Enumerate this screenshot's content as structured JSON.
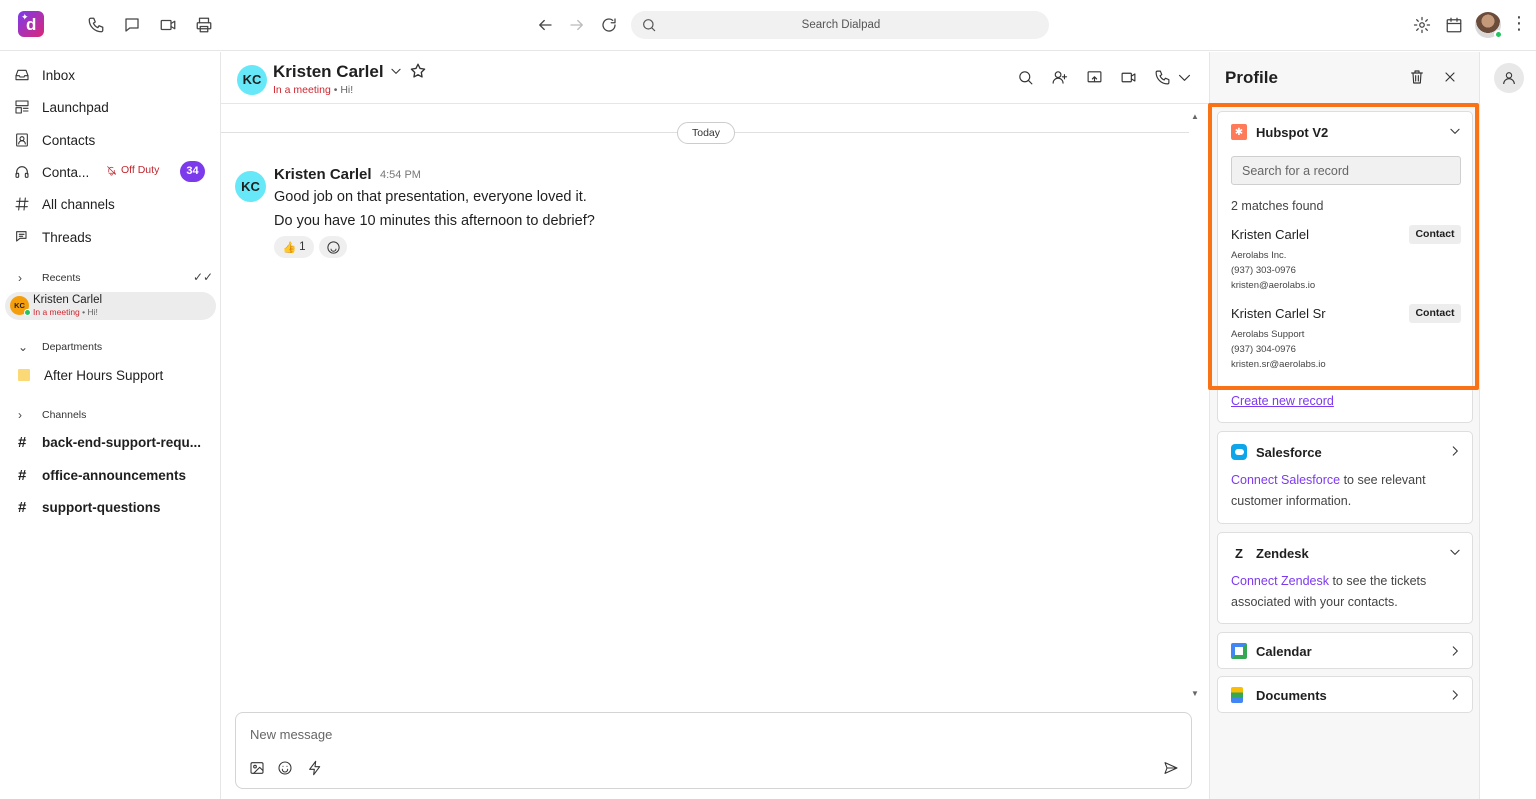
{
  "topbar": {
    "search_placeholder": "Search Dialpad",
    "icons": [
      "phone-icon",
      "chat-icon",
      "video-icon",
      "print-icon",
      "back-icon",
      "forward-icon",
      "refresh-icon",
      "settings-icon",
      "calendar-icon",
      "user-avatar",
      "kebab-icon"
    ]
  },
  "sidebar": {
    "items": [
      {
        "label": "Inbox",
        "icon": "inbox-icon"
      },
      {
        "label": "Launchpad",
        "icon": "launchpad-icon"
      },
      {
        "label": "Contacts",
        "icon": "contacts-icon"
      },
      {
        "label": "Conta...",
        "icon": "headset-icon",
        "status": "Off Duty",
        "badge": "34"
      },
      {
        "label": "All channels",
        "icon": "hash-icon"
      },
      {
        "label": "Threads",
        "icon": "threads-icon"
      }
    ],
    "recents": {
      "title": "Recents",
      "item": {
        "initials": "KC",
        "name": "Kristen Carlel",
        "status": "In a meeting",
        "message": "Hi!"
      }
    },
    "departments": {
      "title": "Departments",
      "items": [
        "After Hours Support"
      ]
    },
    "channels": {
      "title": "Channels",
      "items": [
        "back-end-support-requ...",
        "office-announcements",
        "support-questions"
      ]
    }
  },
  "conversation": {
    "initials": "KC",
    "name": "Kristen Carlel",
    "status": "In a meeting",
    "status_sep": "•",
    "status_message": "Hi!",
    "date_divider": "Today",
    "message": {
      "author": "Kristen Carlel",
      "time": "4:54 PM",
      "lines": [
        "Good job on that presentation, everyone loved it.",
        "Do you have 10 minutes this afternoon to debrief?"
      ],
      "reaction": {
        "emoji": "👍",
        "count": "1"
      }
    },
    "composer_placeholder": "New message"
  },
  "profile": {
    "title": "Profile",
    "hubspot": {
      "title": "Hubspot V2",
      "search_placeholder": "Search for a record",
      "matches": "2 matches found",
      "records": [
        {
          "name": "Kristen Carlel",
          "tag": "Contact",
          "company": "Aerolabs Inc.",
          "phone": "(937) 303-0976",
          "email": "kristen@aerolabs.io"
        },
        {
          "name": "Kristen Carlel Sr",
          "tag": "Contact",
          "company": "Aerolabs Support",
          "phone": "(937) 304-0976",
          "email": "kristen.sr@aerolabs.io"
        }
      ],
      "create_link": "Create new record"
    },
    "salesforce": {
      "title": "Salesforce",
      "link": "Connect Salesforce",
      "text": " to see relevant customer information."
    },
    "zendesk": {
      "title": "Zendesk",
      "link": "Connect Zendesk",
      "text": " to see the tickets associated with your contacts."
    },
    "calendar": {
      "title": "Calendar"
    },
    "documents": {
      "title": "Documents"
    }
  },
  "colors": {
    "accent": "#7c3aed",
    "highlight": "#f97316",
    "status_red": "#d0262f",
    "avatar_cyan": "#67e8f9"
  }
}
